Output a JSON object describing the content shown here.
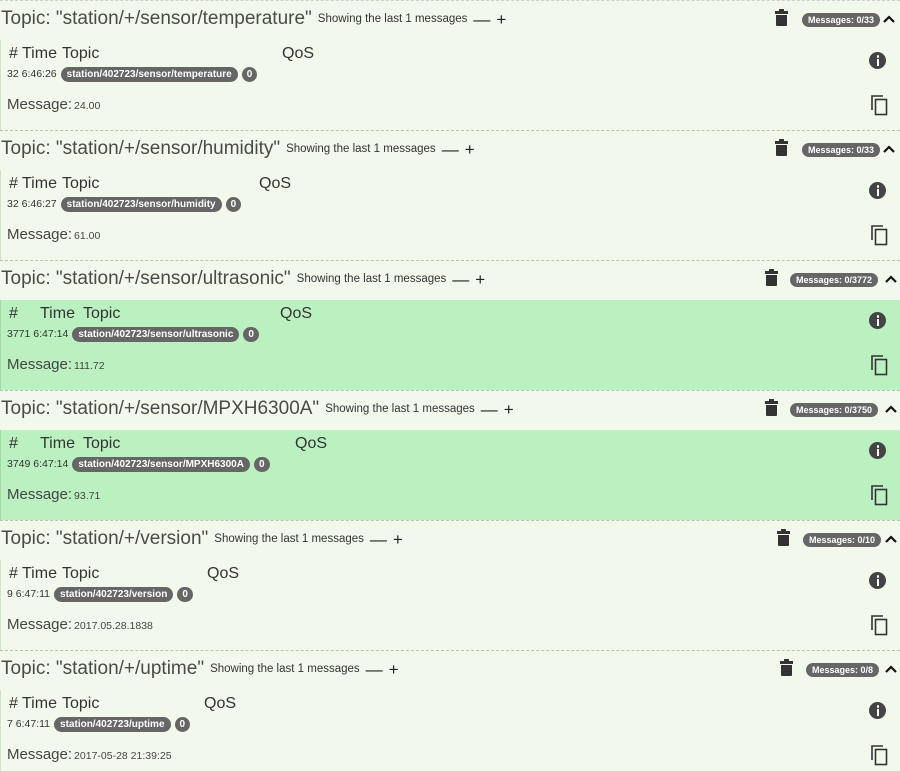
{
  "messages_label": "Message:",
  "showing_label": "Showing the last 1 messages",
  "header": {
    "hash": "#",
    "time": "Time",
    "topic": "Topic",
    "qos": "QoS"
  },
  "topics": [
    {
      "title": "Topic: \"station/+/sensor/temperature\"",
      "badge": "Messages: 0/33",
      "num": "32",
      "time": "6:46:26",
      "topic": "station/402723/sensor/temperature",
      "qos": "0",
      "message": "24.00",
      "active": false
    },
    {
      "title": "Topic: \"station/+/sensor/humidity\"",
      "badge": "Messages: 0/33",
      "num": "32",
      "time": "6:46:27",
      "topic": "station/402723/sensor/humidity",
      "qos": "0",
      "message": "61.00",
      "active": false
    },
    {
      "title": "Topic: \"station/+/sensor/ultrasonic\"",
      "badge": "Messages: 0/3772",
      "num": "3771",
      "time": "6:47:14",
      "topic": "station/402723/sensor/ultrasonic",
      "qos": "0",
      "message": "111.72",
      "active": true
    },
    {
      "title": "Topic: \"station/+/sensor/MPXH6300A\"",
      "badge": "Messages: 0/3750",
      "num": "3749",
      "time": "6:47:14",
      "topic": "station/402723/sensor/MPXH6300A",
      "qos": "0",
      "message": "93.71",
      "active": true
    },
    {
      "title": "Topic: \"station/+/version\"",
      "badge": "Messages: 0/10",
      "num": "9",
      "time": "6:47:11",
      "topic": "station/402723/version",
      "qos": "0",
      "message": "2017.05.28.1838",
      "active": false
    },
    {
      "title": "Topic: \"station/+/uptime\"",
      "badge": "Messages: 0/8",
      "num": "7",
      "time": "6:47:11",
      "topic": "station/402723/uptime",
      "qos": "0",
      "message": "2017-05-28 21:39:25",
      "active": false
    }
  ],
  "colors": {
    "inactive_bg": "#f2f9ec",
    "active_bg": "#bbf1c0",
    "pill": "#666666"
  },
  "icons": {
    "delete": "trash-icon",
    "collapse": "chevron-up-icon",
    "info": "info-icon",
    "copy": "copy-icon",
    "minus": "minus-icon",
    "plus": "plus-icon"
  }
}
